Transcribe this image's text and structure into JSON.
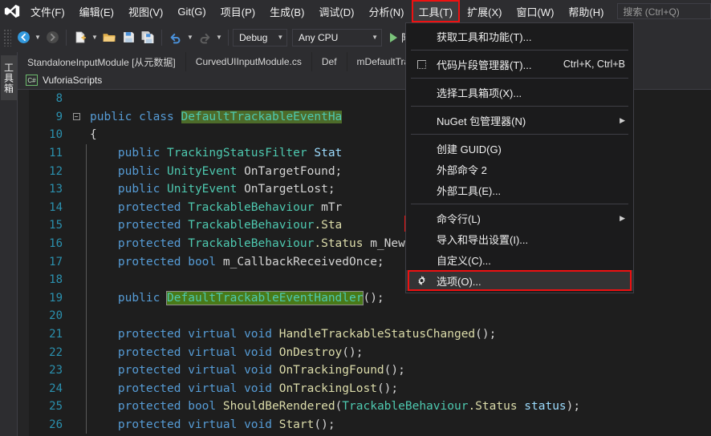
{
  "app": {
    "logo_icon": "visual-studio-logo",
    "accent_red": "#ee1111",
    "menu_bg": "#2d2d30",
    "editor_bg": "#1e1e1e"
  },
  "menubar": {
    "items": [
      {
        "label": "文件(F)",
        "name": "menu-file",
        "active": false
      },
      {
        "label": "编辑(E)",
        "name": "menu-edit",
        "active": false
      },
      {
        "label": "视图(V)",
        "name": "menu-view",
        "active": false
      },
      {
        "label": "Git(G)",
        "name": "menu-git",
        "active": false
      },
      {
        "label": "项目(P)",
        "name": "menu-project",
        "active": false
      },
      {
        "label": "生成(B)",
        "name": "menu-build",
        "active": false
      },
      {
        "label": "调试(D)",
        "name": "menu-debug",
        "active": false
      },
      {
        "label": "分析(N)",
        "name": "menu-analyze",
        "active": false
      },
      {
        "label": "工具(T)",
        "name": "menu-tools",
        "active": true
      },
      {
        "label": "扩展(X)",
        "name": "menu-extensions",
        "active": false
      },
      {
        "label": "窗口(W)",
        "name": "menu-window",
        "active": false
      },
      {
        "label": "帮助(H)",
        "name": "menu-help",
        "active": false
      }
    ],
    "search": {
      "placeholder": "搜索 (Ctrl+Q)",
      "value": ""
    }
  },
  "toolbar": {
    "nav_back_icon": "navigate-back-icon",
    "nav_forward_icon": "navigate-forward-icon",
    "new_item_icon": "new-item-icon",
    "open_icon": "open-folder-icon",
    "save_icon": "save-icon",
    "save_all_icon": "save-all-icon",
    "undo_icon": "undo-icon",
    "redo_icon": "redo-icon",
    "configuration": {
      "label": "Debug",
      "name": "solution-configuration"
    },
    "platform": {
      "label": "Any CPU",
      "name": "solution-platform"
    },
    "run": {
      "label": "附加",
      "name": "attach-to-process-button"
    }
  },
  "rail": {
    "toolbox_label": "工具箱"
  },
  "tabs": [
    {
      "label": "StandaloneInputModule [从元数据]",
      "name": "tab-standalone-input-module",
      "selected": false
    },
    {
      "label": "CurvedUIInputModule.cs",
      "name": "tab-curvedui-input-module",
      "selected": false
    },
    {
      "label": "Def",
      "name": "tab-default-trackable-partial",
      "selected": false
    },
    {
      "label": "mDefaultTra...eEv",
      "name": "tab-default-trackable-event-handler",
      "selected": false
    }
  ],
  "breadcrumb": {
    "project_icon": "csharp-project-icon",
    "project_badge": "C#",
    "project": "VuforiaScripts"
  },
  "editor": {
    "gear_marker_icon": "gear-icon",
    "lines": [
      {
        "num": "8",
        "fold": "",
        "guide": false,
        "tokens": []
      },
      {
        "num": "9",
        "fold": "minus",
        "guide": false,
        "tokens": [
          {
            "t": "public ",
            "c": "k"
          },
          {
            "t": "class ",
            "c": "k"
          },
          {
            "t": "DefaultTrackableEventHa",
            "c": "t hl"
          }
        ]
      },
      {
        "num": "10",
        "fold": "",
        "guide": false,
        "tokens": [
          {
            "t": "{",
            "c": "p"
          }
        ]
      },
      {
        "num": "11",
        "fold": "",
        "guide": true,
        "tokens": [
          {
            "t": "    public ",
            "c": "k"
          },
          {
            "t": "TrackingStatusFilter ",
            "c": "t"
          },
          {
            "t": "Stat",
            "c": "v"
          }
        ]
      },
      {
        "num": "12",
        "fold": "",
        "guide": true,
        "tokens": [
          {
            "t": "    public ",
            "c": "k"
          },
          {
            "t": "UnityEvent ",
            "c": "t"
          },
          {
            "t": "OnTargetFound;",
            "c": "p"
          }
        ]
      },
      {
        "num": "13",
        "fold": "",
        "guide": true,
        "tokens": [
          {
            "t": "    public ",
            "c": "k"
          },
          {
            "t": "UnityEvent ",
            "c": "t"
          },
          {
            "t": "OnTargetLost;",
            "c": "p"
          }
        ]
      },
      {
        "num": "14",
        "fold": "",
        "guide": true,
        "tokens": [
          {
            "t": "    protected ",
            "c": "k"
          },
          {
            "t": "TrackableBehaviour ",
            "c": "t"
          },
          {
            "t": "mTr",
            "c": "p"
          }
        ]
      },
      {
        "num": "15",
        "fold": "",
        "guide": true,
        "tokens": [
          {
            "t": "    protected ",
            "c": "k"
          },
          {
            "t": "TrackableBehaviour",
            "c": "t"
          },
          {
            "t": ".Sta",
            "c": "id"
          }
        ]
      },
      {
        "num": "16",
        "fold": "",
        "guide": true,
        "tokens": [
          {
            "t": "    protected ",
            "c": "k"
          },
          {
            "t": "TrackableBehaviour",
            "c": "t"
          },
          {
            "t": ".Status ",
            "c": "id"
          },
          {
            "t": "m_NewStatus;",
            "c": "p"
          }
        ]
      },
      {
        "num": "17",
        "fold": "",
        "guide": true,
        "tokens": [
          {
            "t": "    protected ",
            "c": "k"
          },
          {
            "t": "bool ",
            "c": "k"
          },
          {
            "t": "m_CallbackReceivedOnce;",
            "c": "p"
          }
        ]
      },
      {
        "num": "18",
        "fold": "",
        "guide": true,
        "tokens": []
      },
      {
        "num": "19",
        "fold": "",
        "guide": true,
        "tokens": [
          {
            "t": "    public ",
            "c": "k"
          },
          {
            "t": "DefaultTrackableEventHandler",
            "c": "t hl-strong"
          },
          {
            "t": "();",
            "c": "p"
          }
        ]
      },
      {
        "num": "20",
        "fold": "",
        "guide": true,
        "tokens": []
      },
      {
        "num": "21",
        "fold": "",
        "guide": true,
        "tokens": [
          {
            "t": "    protected ",
            "c": "k"
          },
          {
            "t": "virtual ",
            "c": "k"
          },
          {
            "t": "void ",
            "c": "k"
          },
          {
            "t": "HandleTrackableStatusChanged",
            "c": "id"
          },
          {
            "t": "();",
            "c": "p"
          }
        ]
      },
      {
        "num": "22",
        "fold": "",
        "guide": true,
        "tokens": [
          {
            "t": "    protected ",
            "c": "k"
          },
          {
            "t": "virtual ",
            "c": "k"
          },
          {
            "t": "void ",
            "c": "k"
          },
          {
            "t": "OnDestroy",
            "c": "id"
          },
          {
            "t": "();",
            "c": "p"
          }
        ]
      },
      {
        "num": "23",
        "fold": "",
        "guide": true,
        "tokens": [
          {
            "t": "    protected ",
            "c": "k"
          },
          {
            "t": "virtual ",
            "c": "k"
          },
          {
            "t": "void ",
            "c": "k"
          },
          {
            "t": "OnTrackingFound",
            "c": "id"
          },
          {
            "t": "();",
            "c": "p"
          }
        ]
      },
      {
        "num": "24",
        "fold": "",
        "guide": true,
        "tokens": [
          {
            "t": "    protected ",
            "c": "k"
          },
          {
            "t": "virtual ",
            "c": "k"
          },
          {
            "t": "void ",
            "c": "k"
          },
          {
            "t": "OnTrackingLost",
            "c": "id"
          },
          {
            "t": "();",
            "c": "p"
          }
        ]
      },
      {
        "num": "25",
        "fold": "",
        "guide": true,
        "tokens": [
          {
            "t": "    protected ",
            "c": "k"
          },
          {
            "t": "bool ",
            "c": "k"
          },
          {
            "t": "ShouldBeRendered",
            "c": "id"
          },
          {
            "t": "(",
            "c": "p"
          },
          {
            "t": "TrackableBehaviour",
            "c": "t"
          },
          {
            "t": ".Status ",
            "c": "id"
          },
          {
            "t": "status",
            "c": "v"
          },
          {
            "t": ");",
            "c": "p"
          }
        ]
      },
      {
        "num": "26",
        "fold": "",
        "guide": true,
        "tokens": [
          {
            "t": "    protected ",
            "c": "k"
          },
          {
            "t": "virtual ",
            "c": "k"
          },
          {
            "t": "void ",
            "c": "k"
          },
          {
            "t": "Start",
            "c": "id"
          },
          {
            "t": "();",
            "c": "p"
          }
        ]
      }
    ]
  },
  "dropdown": {
    "name": "tools-menu-dropdown",
    "items": [
      {
        "kind": "item",
        "label": "获取工具和功能(T)...",
        "name": "menu-get-tools-and-features",
        "icon": "",
        "shortcut": "",
        "submenu": false
      },
      {
        "kind": "sep"
      },
      {
        "kind": "item",
        "label": "代码片段管理器(T)...",
        "name": "menu-code-snippets-manager",
        "icon": "snippet-box-icon",
        "shortcut": "Ctrl+K, Ctrl+B",
        "submenu": false
      },
      {
        "kind": "sep"
      },
      {
        "kind": "item",
        "label": "选择工具箱项(X)...",
        "name": "menu-choose-toolbox-items",
        "icon": "",
        "shortcut": "",
        "submenu": false
      },
      {
        "kind": "sep"
      },
      {
        "kind": "item",
        "label": "NuGet 包管理器(N)",
        "name": "menu-nuget-package-manager",
        "icon": "",
        "shortcut": "",
        "submenu": true
      },
      {
        "kind": "sep"
      },
      {
        "kind": "item",
        "label": "创建 GUID(G)",
        "name": "menu-create-guid",
        "icon": "",
        "shortcut": "",
        "submenu": false
      },
      {
        "kind": "item",
        "label": "外部命令 2",
        "name": "menu-external-command-2",
        "icon": "",
        "shortcut": "",
        "submenu": false
      },
      {
        "kind": "item",
        "label": "外部工具(E)...",
        "name": "menu-external-tools",
        "icon": "",
        "shortcut": "",
        "submenu": false
      },
      {
        "kind": "sep"
      },
      {
        "kind": "item",
        "label": "命令行(L)",
        "name": "menu-command-line",
        "icon": "",
        "shortcut": "",
        "submenu": true
      },
      {
        "kind": "item",
        "label": "导入和导出设置(I)...",
        "name": "menu-import-export-settings",
        "icon": "",
        "shortcut": "",
        "submenu": false
      },
      {
        "kind": "item",
        "label": "自定义(C)...",
        "name": "menu-customize",
        "icon": "",
        "shortcut": "",
        "submenu": false
      },
      {
        "kind": "item",
        "label": "选项(O)...",
        "name": "menu-options",
        "icon": "gear-icon",
        "shortcut": "",
        "submenu": false,
        "highlighted": true
      }
    ]
  }
}
